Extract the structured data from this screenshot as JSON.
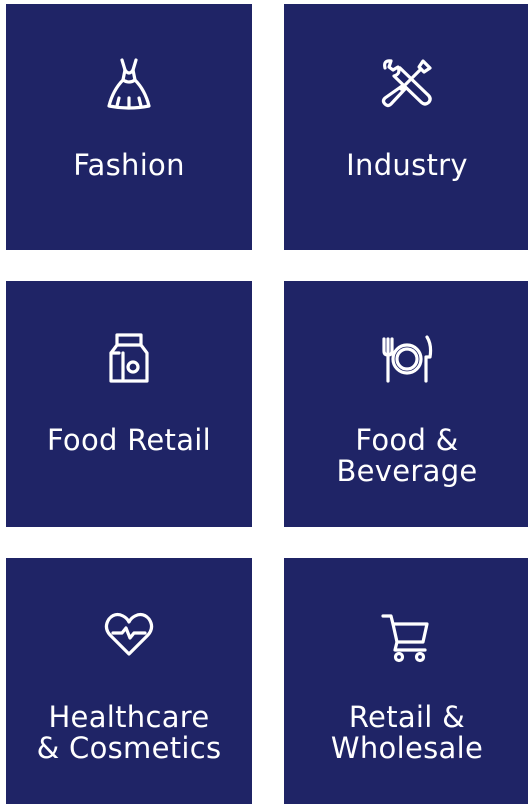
{
  "colors": {
    "tile_background": "#1f2466",
    "text": "#ffffff",
    "page_background": "#ffffff"
  },
  "tiles": [
    {
      "label": "Fashion",
      "icon": "dress-icon"
    },
    {
      "label": "Industry",
      "icon": "tools-icon"
    },
    {
      "label": "Food Retail",
      "icon": "grocery-bag-icon"
    },
    {
      "label": "Food &\nBeverage",
      "icon": "plate-cutlery-icon"
    },
    {
      "label": "Healthcare\n& Cosmetics",
      "icon": "heart-pulse-icon"
    },
    {
      "label": "Retail &\nWholesale",
      "icon": "shopping-cart-icon"
    }
  ]
}
